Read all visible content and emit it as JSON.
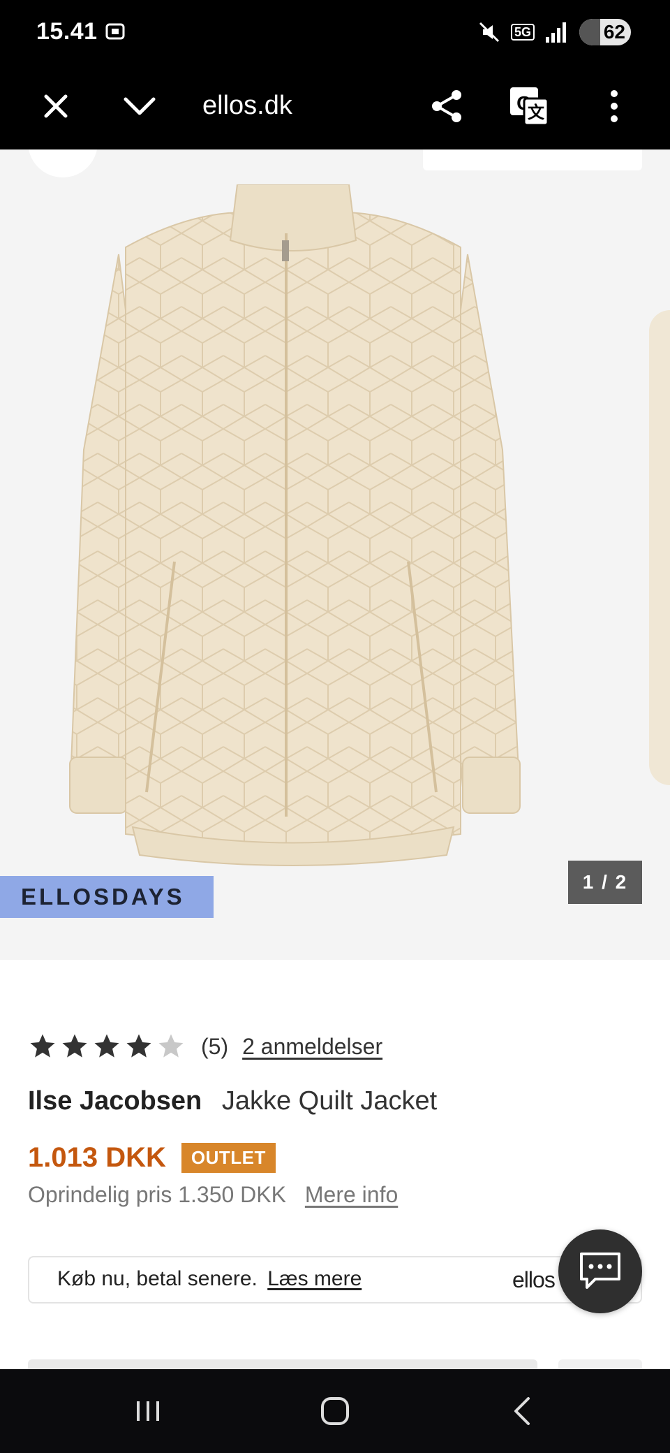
{
  "status_bar": {
    "time": "15.41",
    "network": "5G",
    "battery": "62"
  },
  "browser": {
    "url": "ellos.dk",
    "icons": [
      "close-icon",
      "chevron-down-icon",
      "share-icon",
      "translate-icon",
      "more-vert-icon"
    ]
  },
  "gallery": {
    "campaign_badge": "ELLOSDAYS",
    "image_counter": "1 / 2",
    "jacket_color": "#efe3cc"
  },
  "product": {
    "rating": 4,
    "rating_max": 5,
    "review_count": "(5)",
    "reviews_link": "2 anmeldelser",
    "brand": "Ilse Jacobsen",
    "name": "Jakke Quilt Jacket",
    "price": "1.013 DKK",
    "badge": "OUTLET",
    "original_price": "Oprindelig pris 1.350 DKK",
    "more_info": "Mere info"
  },
  "bnpl": {
    "text": "Køb nu, betal senere.",
    "link": "Læs mere",
    "logo": "ellos"
  },
  "colors": {
    "price": "#c4570e",
    "outlet_badge": "#d8862a",
    "campaign_badge": "#8fa8e6",
    "star_filled": "#333333",
    "star_empty": "#c8c8c8"
  },
  "nav": {
    "icons": [
      "recent-apps-icon",
      "home-icon",
      "back-icon"
    ]
  }
}
